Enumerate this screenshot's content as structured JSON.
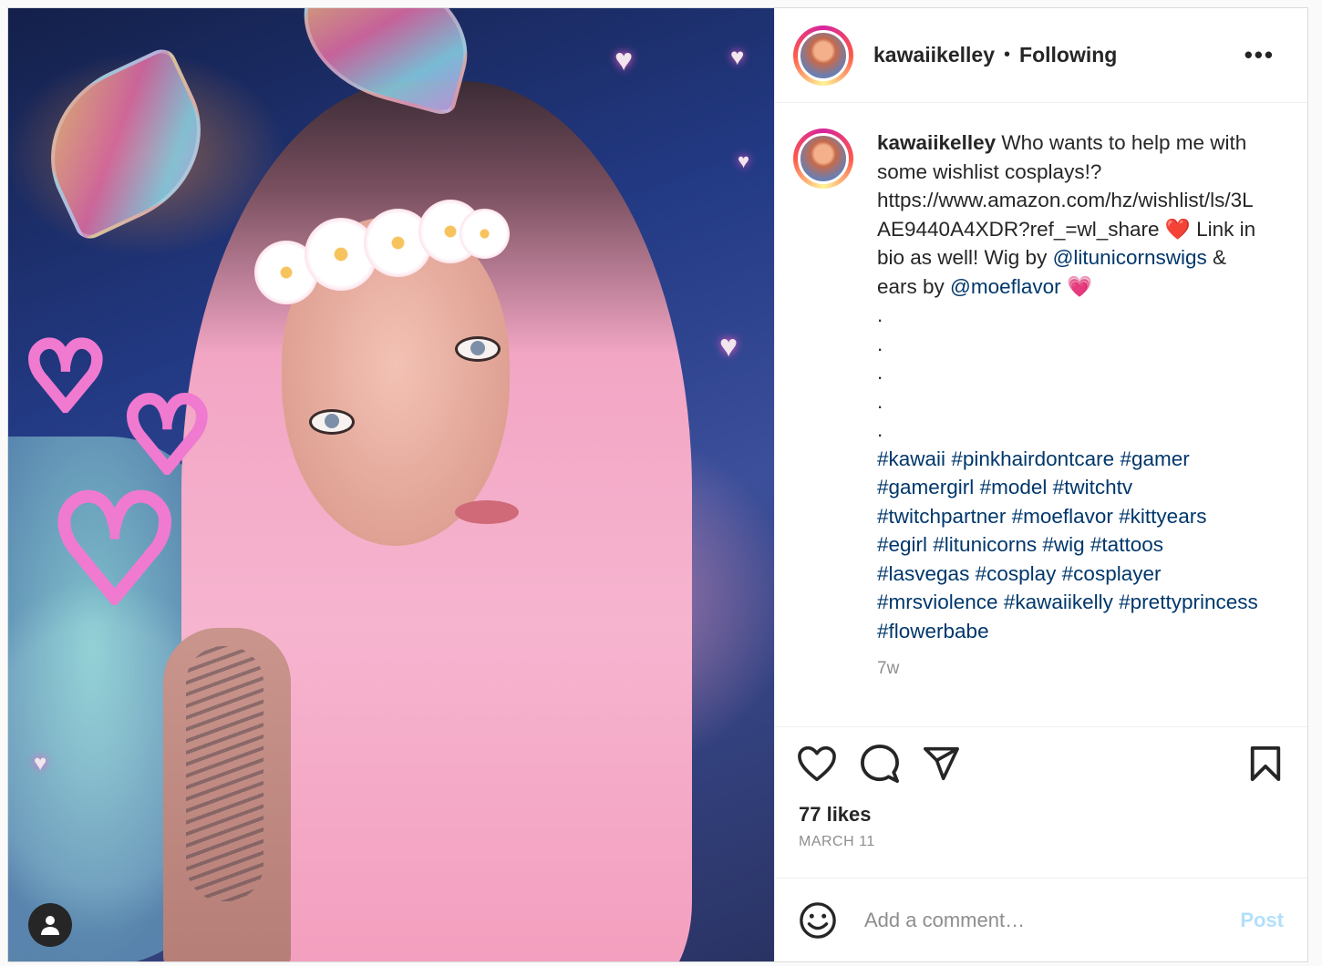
{
  "post": {
    "username": "kawaiikelley",
    "separator": "•",
    "follow_status": "Following",
    "more_label": "•••"
  },
  "caption": {
    "username": "kawaiikelley",
    "text_1": " Who wants to help me with some wishlist cosplays!? https://www.amazon.com/hz/wishlist/ls/3LAE9440A4XDR?ref_=wl_share ",
    "emoji_1": "❤️",
    "text_2": " Link in bio as well! Wig by ",
    "mention_1": "@litunicornswigs",
    "text_3": " & ears by ",
    "mention_2": "@moeflavor",
    "emoji_2": "💗",
    "dots": [
      ".",
      ".",
      ".",
      ".",
      "."
    ],
    "hashtags": [
      "#kawaii",
      "#pinkhairdontcare",
      "#gamer",
      "#gamergirl",
      "#model",
      "#twitchtv",
      "#twitchpartner",
      "#moeflavor",
      "#kittyears",
      "#egirl",
      "#litunicorns",
      "#wig",
      "#tattoos",
      "#lasvegas",
      "#cosplay",
      "#cosplayer",
      "#mrsviolence",
      "#kawaiikelly",
      "#prettyprincess",
      "#flowerbabe"
    ],
    "time_ago": "7w"
  },
  "actions": {
    "likes": "77 likes",
    "date": "MARCH 11"
  },
  "comment": {
    "placeholder": "Add a comment…",
    "post_label": "Post"
  },
  "icons": [
    "heart-icon",
    "comment-icon",
    "share-icon",
    "bookmark-icon",
    "emoji-icon",
    "person-icon",
    "more-icon"
  ],
  "colors": {
    "link": "#00376b",
    "post_button": "#b2dffc",
    "muted": "#8e8e8e"
  }
}
